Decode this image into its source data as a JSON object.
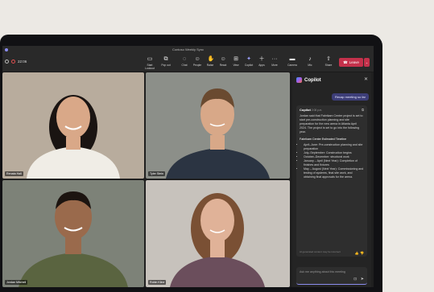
{
  "window": {
    "title": "Contoso Weekly Sync"
  },
  "call": {
    "timer": "22:06"
  },
  "toolbar": {
    "buttons": [
      {
        "label": "Start Lookout",
        "icon": "camera-outline-icon"
      },
      {
        "label": "Pop out",
        "icon": "popout-icon"
      },
      {
        "label": "Chat",
        "icon": "chat-icon"
      },
      {
        "label": "People",
        "icon": "people-icon"
      },
      {
        "label": "Raise",
        "icon": "hand-icon"
      },
      {
        "label": "React",
        "icon": "smile-icon"
      },
      {
        "label": "View",
        "icon": "grid-view-icon"
      },
      {
        "label": "Copilot",
        "icon": "copilot-icon"
      },
      {
        "label": "Apps",
        "icon": "apps-icon"
      },
      {
        "label": "More",
        "icon": "more-icon"
      },
      {
        "label": "Camera",
        "icon": "video-icon"
      },
      {
        "label": "Mic",
        "icon": "mic-icon"
      },
      {
        "label": "Share",
        "icon": "share-icon"
      }
    ],
    "leave_label": "Leave"
  },
  "participants": [
    {
      "name": "Renata Hall",
      "bg": "#b8ac9d",
      "skin": "#d9a888",
      "hair": "#1a1412",
      "shirt": "#f0ede6"
    },
    {
      "name": "Tyler Stein",
      "bg": "#8c8f89",
      "skin": "#d8a888",
      "hair": "#6a4a30",
      "shirt": "#2b3442"
    },
    {
      "name": "Jordan Mitchell",
      "bg": "#7d8278",
      "skin": "#9a6a4c",
      "hair": "#1c1410",
      "shirt": "#5a6440"
    },
    {
      "name": "Robin Kline",
      "bg": "#c7c2bc",
      "skin": "#e0b298",
      "hair": "#7a5034",
      "shirt": "#6b4e5c"
    }
  ],
  "copilot": {
    "title": "Copilot",
    "user_prompt": "Recap meeting so far",
    "response_author": "Copilot",
    "response_time": "2:08 p.m.",
    "summary": "Jordan said that Fabrikam Center project is set to start pre-construction planning and site preparation for the new arena in Atlanta April 2024. The project is set to go into the following year.",
    "timeline_title": "Fabrikam Center Estimated Timeline",
    "timeline": [
      "April–June: Pre-construction planning and site preparation",
      "July–September: Construction begins",
      "October–December: structural work",
      "January – April (Next Year): Completion of finishes and fixtures",
      "May – August (Next Year): Commissioning and testing of systems, final site work, and obtaining final approvals for the arena."
    ],
    "disclaimer": "AI generated content may be incorrect",
    "input_placeholder": "Ask me anything about this meeting"
  }
}
